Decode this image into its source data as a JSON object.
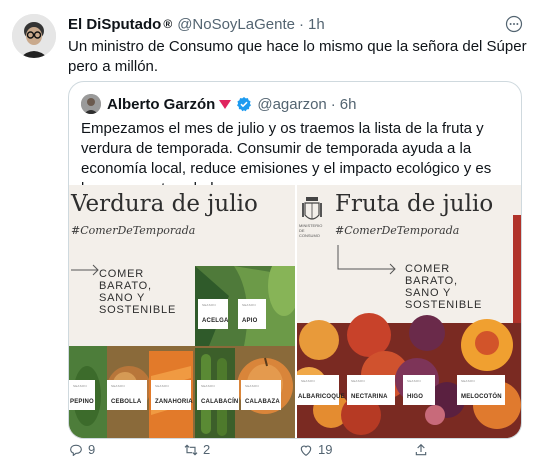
{
  "tweet": {
    "author_name": "El DiSputado",
    "registered_mark": "®",
    "handle": "@NoSoyLaGente",
    "separator": "·",
    "time": "1h",
    "text": "Un ministro de Consumo que hace lo mismo que la señora del Súper pero a millón."
  },
  "quote": {
    "author_name": "Alberto Garzón",
    "handle": "@agarzon",
    "separator": "·",
    "time": "6h",
    "text": "Empezamos el mes de julio y os traemos la lista de la fruta y verdura de temporada. Consumir de temporada ayuda a la economía local, reduce emisiones y el impacto ecológico y es bueno para tu salud.",
    "verified_color": "#1d9bf0",
    "party_color": "#e0245e"
  },
  "media": {
    "left": {
      "title": "Verdura de julio",
      "hashtag": "#ComerDeTemporada",
      "slogan": "COMER\nBARATO,\nSANO Y\nSOSTENIBLE",
      "labels": [
        "ACELGA",
        "APIO",
        "PEPINO",
        "CEBOLLA",
        "ZANAHORIA",
        "CALABACÍN",
        "CALABAZA"
      ]
    },
    "right": {
      "title": "Fruta de julio",
      "hashtag": "#ComerDeTemporada",
      "slogan": "COMER\nBARATO,\nSANO Y\nSOSTENIBLE",
      "gov_label": "MINISTERIO DE CONSUMO",
      "labels": [
        "ALBARICOQUE",
        "NECTARINA",
        "HIGO",
        "MELOCOTÓN"
      ]
    }
  },
  "footer": {
    "reply_count": "9",
    "retweet_count": "2",
    "like_count": "19",
    "share_label": ""
  }
}
